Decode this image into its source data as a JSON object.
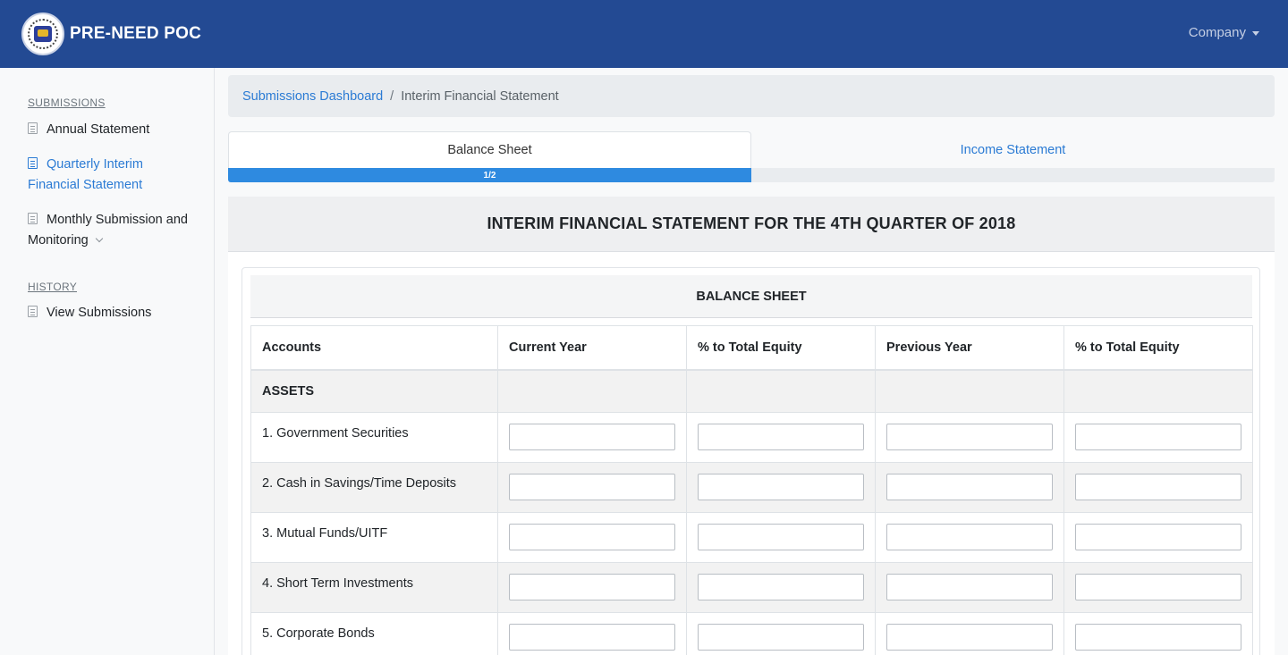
{
  "navbar": {
    "brand": "PRE-NEED POC",
    "logo_icon": "seal-logo-icon",
    "company_label": "Company"
  },
  "sidebar": {
    "headings": {
      "submissions": "SUBMISSIONS",
      "history": "HISTORY"
    },
    "items": [
      {
        "label": "Annual Statement",
        "icon": "document-icon"
      },
      {
        "label": "Quarterly Interim Financial Statement",
        "icon": "document-icon",
        "active": true
      },
      {
        "label": "Monthly Submission and Monitoring",
        "icon": "document-icon"
      },
      {
        "label": "View Submissions",
        "icon": "document-icon"
      }
    ]
  },
  "breadcrumb": {
    "link": "Submissions Dashboard",
    "separator": "/",
    "current": "Interim Financial Statement"
  },
  "tabs": [
    {
      "label": "Balance Sheet"
    },
    {
      "label": "Income Statement"
    }
  ],
  "progress": {
    "label": "1/2",
    "fraction": 0.5
  },
  "page": {
    "title": "INTERIM FINANCIAL STATEMENT FOR THE 4TH QUARTER OF 2018",
    "section_title": "BALANCE SHEET"
  },
  "table": {
    "columns": [
      "Accounts",
      "Current Year",
      "% to Total Equity",
      "Previous Year",
      "% to Total Equity"
    ],
    "group": "ASSETS",
    "rows": [
      {
        "label": "1. Government Securities"
      },
      {
        "label": "2. Cash in Savings/Time Deposits"
      },
      {
        "label": "3. Mutual Funds/UITF"
      },
      {
        "label": "4. Short Term Investments"
      },
      {
        "label": "5. Corporate Bonds"
      }
    ]
  },
  "colors": {
    "navbar": "#234a93",
    "accent": "#2b7bd4",
    "progress": "#2e8ae0"
  }
}
